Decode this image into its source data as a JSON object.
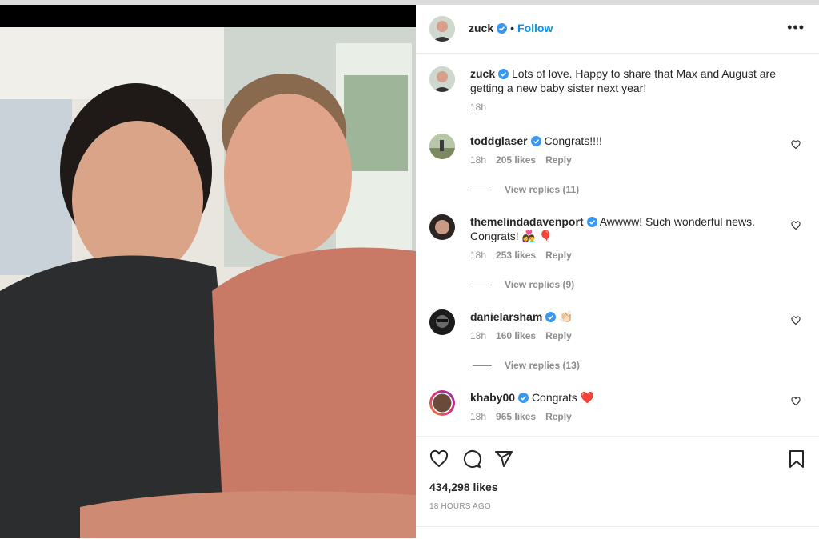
{
  "post": {
    "author": "zuck",
    "follow_label": "Follow",
    "more_label": "•••",
    "caption": "Lots of love. Happy to share that Max and August are getting a new baby sister next year!",
    "caption_time": "18h",
    "likes": "434,298 likes",
    "posted_ago": "18 HOURS AGO"
  },
  "comments": [
    {
      "user": "toddglaser",
      "text": "Congrats!!!!",
      "time": "18h",
      "likes": "205 likes",
      "reply": "Reply",
      "view_replies": "View replies (11)"
    },
    {
      "user": "themelindadavenport",
      "text": "Awwww! Such wonderful news. Congrats! 👩‍❤️‍👨 🎈",
      "time": "18h",
      "likes": "253 likes",
      "reply": "Reply",
      "view_replies": "View replies (9)"
    },
    {
      "user": "danielarsham",
      "text": "👏🏻",
      "time": "18h",
      "likes": "160 likes",
      "reply": "Reply",
      "view_replies": "View replies (13)"
    },
    {
      "user": "khaby00",
      "text": "Congrats ❤️",
      "time": "18h",
      "likes": "965 likes",
      "reply": "Reply"
    }
  ],
  "icons": {
    "like": "heart-icon",
    "comment": "comment-icon",
    "share": "share-icon",
    "save": "bookmark-icon",
    "verified": "verified-badge-icon"
  },
  "colors": {
    "accent": "#0095f6",
    "verified": "#3897f0",
    "muted": "#8e8e8e"
  }
}
